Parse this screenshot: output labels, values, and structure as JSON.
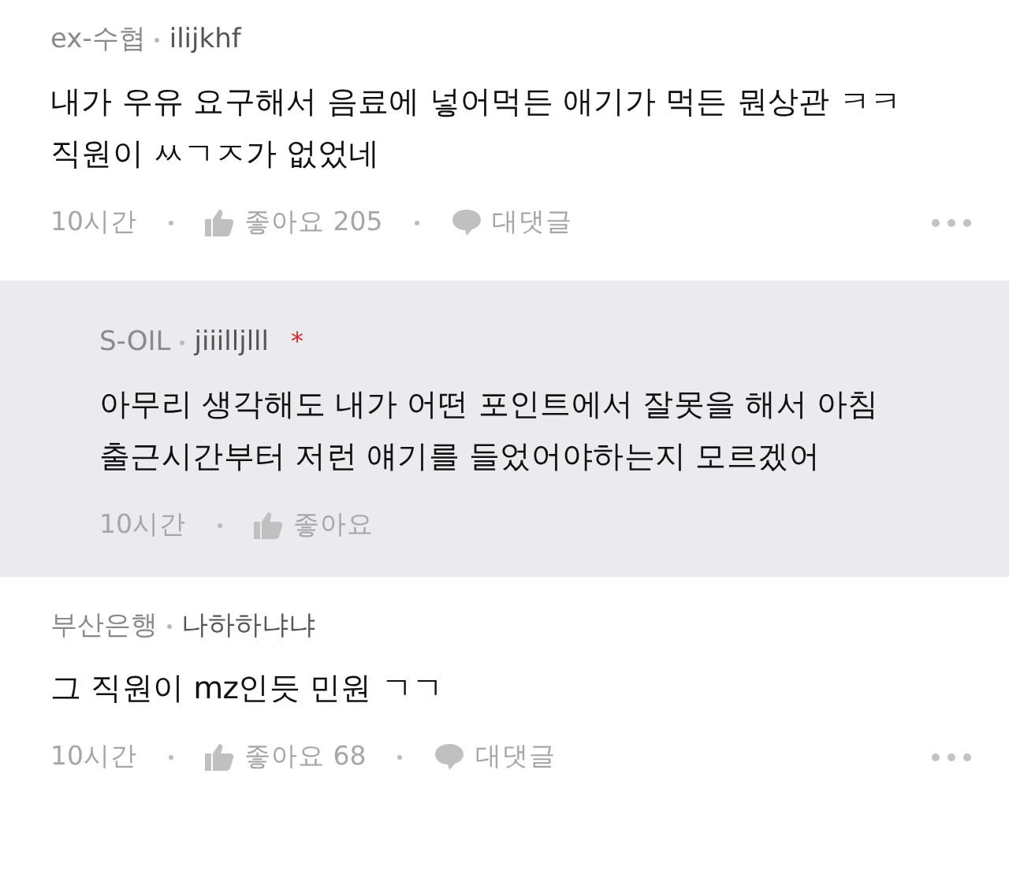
{
  "comments": [
    {
      "kind": "comment",
      "company": "ex-수협",
      "nickname": "ilijkhf",
      "body": "내가 우유 요구해서 음료에 넣어먹든 애기가 먹든 뭔상관 ㅋㅋ\n직원이 ㅆㄱㅈ가 없었네",
      "time": "10시간",
      "like_label": "좋아요",
      "like_count": "205",
      "reply_label": "대댓글"
    },
    {
      "kind": "reply",
      "company": "S-OIL",
      "nickname": "jiiilljlll",
      "author_mark": "*",
      "body": "아무리 생각해도 내가 어떤 포인트에서 잘못을 해서 아침\n출근시간부터 저런 얘기를 들었어야하는지 모르겠어",
      "time": "10시간",
      "like_label": "좋아요"
    },
    {
      "kind": "comment",
      "company": "부산은행",
      "nickname": "나하하냐냐",
      "body": "그 직원이 mz인듯 민원 ㄱㄱ",
      "time": "10시간",
      "like_label": "좋아요",
      "like_count": "68",
      "reply_label": "대댓글"
    }
  ]
}
